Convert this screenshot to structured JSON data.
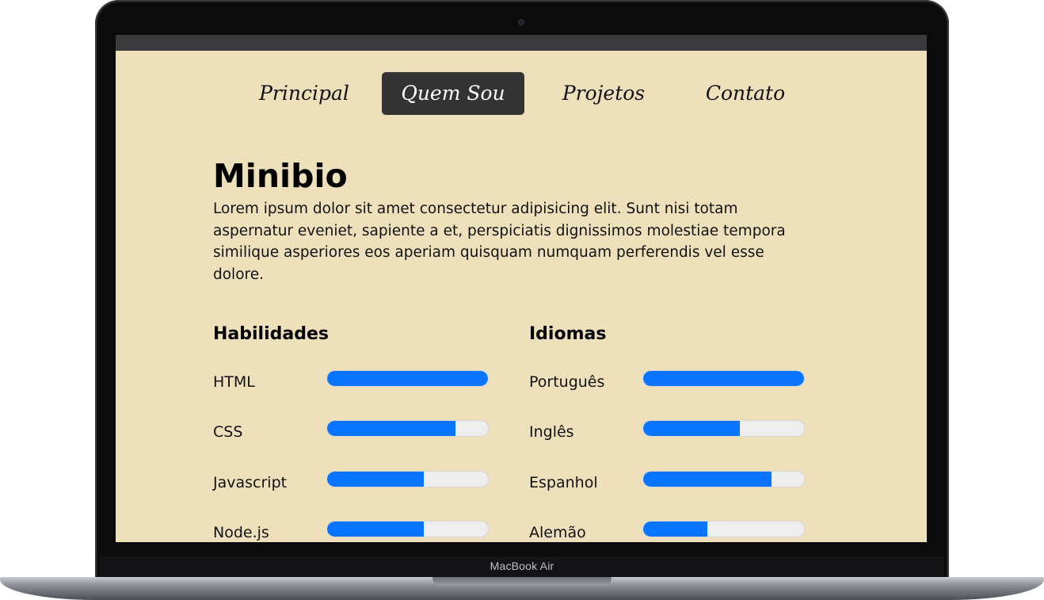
{
  "device": {
    "brand_label": "MacBook Air"
  },
  "nav": {
    "items": [
      {
        "label": "Principal",
        "active": false
      },
      {
        "label": "Quem Sou",
        "active": true
      },
      {
        "label": "Projetos",
        "active": false
      },
      {
        "label": "Contato",
        "active": false
      }
    ]
  },
  "minibio": {
    "title": "Minibio",
    "text": "Lorem ipsum dolor sit amet consectetur adipisicing elit. Sunt nisi totam aspernatur eveniet, sapiente a et, perspiciatis dignissimos molestiae tempora similique asperiores eos aperiam quisquam numquam perferendis vel esse dolore."
  },
  "skills": {
    "title": "Habilidades",
    "items": [
      {
        "label": "HTML",
        "level": 1.0
      },
      {
        "label": "CSS",
        "level": 0.8
      },
      {
        "label": "Javascript",
        "level": 0.6
      },
      {
        "label": "Node.js",
        "level": 0.6
      }
    ]
  },
  "languages": {
    "title": "Idiomas",
    "items": [
      {
        "label": "Português",
        "level": 1.0
      },
      {
        "label": "Inglês",
        "level": 0.6
      },
      {
        "label": "Espanhol",
        "level": 0.8
      },
      {
        "label": "Alemão",
        "level": 0.4
      }
    ]
  },
  "colors": {
    "page_background": "#ede0bb",
    "nav_active_background": "#333333",
    "bar_fill": "#0874ff",
    "bar_track": "#eeeeee"
  }
}
